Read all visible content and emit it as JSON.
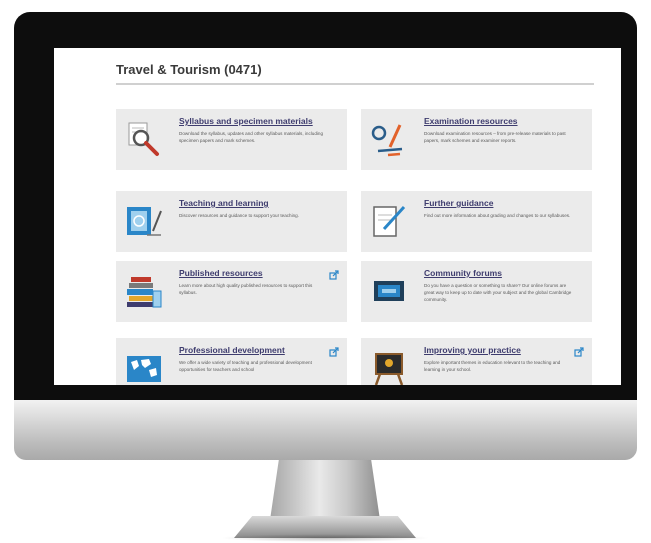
{
  "page": {
    "title": "Travel & Tourism (0471)"
  },
  "cards": [
    {
      "title": "Syllabus and specimen materials",
      "description": "Download the syllabus, updates and other syllabus materials, including specimen papers and mark schemes.",
      "icon": "magnifier-icon"
    },
    {
      "title": "Examination resources",
      "description": "Download examination resources – from pre-release materials to past papers, mark schemes and examiner reports.",
      "icon": "marking-icon"
    },
    {
      "title": "Teaching and learning",
      "description": "Discover resources and guidance to support your teaching.",
      "icon": "teaching-book-icon"
    },
    {
      "title": "Further guidance",
      "description": "Find out more information about grading and changes to our syllabuses.",
      "icon": "notepad-pen-icon"
    },
    {
      "title": "Published resources",
      "description": "Learn more about high quality published resources to support this syllabus.",
      "icon": "books-icon",
      "external": true
    },
    {
      "title": "Community forums",
      "description": "Do you have a question or something to share? Our online forums are great way to keep up to date with your subject and the global Cambridge community.",
      "icon": "chat-board-icon"
    },
    {
      "title": "Professional development",
      "description": "We offer a wide variety of teaching and professional development opportunities for teachers and school",
      "icon": "world-map-icon",
      "external": true
    },
    {
      "title": "Improving your practice",
      "description": "Explore important themes in education relevant to the teaching and learning in your school.",
      "icon": "easel-icon",
      "external": true
    }
  ],
  "colors": {
    "card_background": "#ebebeb",
    "link_title": "#3e3c6e",
    "monitor_bezel": "#0d0d0d",
    "accent_blue": "#2a86c8"
  }
}
